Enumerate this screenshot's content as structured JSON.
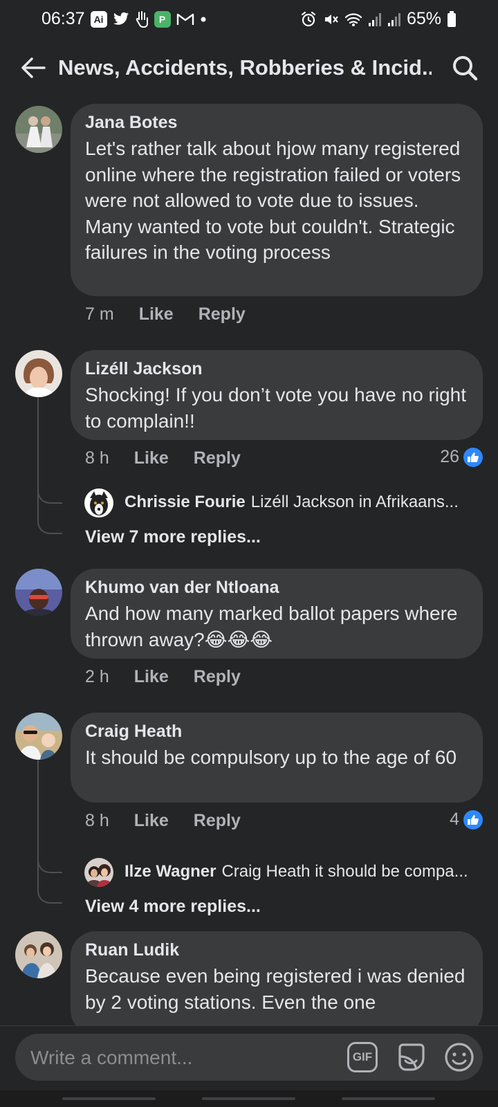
{
  "status_bar": {
    "time": "06:37",
    "battery": "65%",
    "left_icons": [
      "ai-icon",
      "twitter-icon",
      "hand-icon",
      "pushbullet-icon",
      "gmail-icon",
      "dot-icon"
    ],
    "right_icons": [
      "alarm-icon",
      "mute-icon",
      "wifi-icon",
      "signal-icon",
      "signal-icon",
      "battery-icon"
    ]
  },
  "header": {
    "title": "News, Accidents, Robberies & Incid..."
  },
  "comments": [
    {
      "author": "Jana Botes",
      "text": "Let's rather talk about hjow many registered online where the registration failed or voters were not allowed to vote due to issues. Many wanted to vote but couldn't. Strategic failures in the voting process",
      "time": "7 m",
      "like": "Like",
      "reply": "Reply"
    },
    {
      "author": "Lizéll Jackson",
      "text": "Shocking! If you don’t vote you have no right to complain!!",
      "time": "8 h",
      "like": "Like",
      "reply": "Reply",
      "reaction_count": "26",
      "reply_preview": {
        "author": "Chrissie Fourie",
        "text": "Lizéll Jackson in Afrikaans..."
      },
      "view_more": "View 7 more replies..."
    },
    {
      "author": "Khumo van der Ntloana",
      "text": "And how many marked ballot papers where thrown away?",
      "emoji": "😂😂😂",
      "time": "2 h",
      "like": "Like",
      "reply": "Reply"
    },
    {
      "author": "Craig Heath",
      "text": "It should be compulsory up to the age of 60",
      "time": "8 h",
      "like": "Like",
      "reply": "Reply",
      "reaction_count": "4",
      "reply_preview": {
        "author": "Ilze Wagner",
        "text": "Craig Heath it should be compa..."
      },
      "view_more": "View 4 more replies..."
    },
    {
      "author": "Ruan Ludik",
      "text": "Because even being registered i was denied by 2 voting stations. Even the one"
    }
  ],
  "composer": {
    "placeholder": "Write a comment...",
    "gif_label": "GIF"
  },
  "colors": {
    "background": "#242526",
    "bubble": "#3a3b3c",
    "text_primary": "#e4e6eb",
    "text_secondary": "#b0b3b8",
    "like_blue": "#2d88ff"
  }
}
